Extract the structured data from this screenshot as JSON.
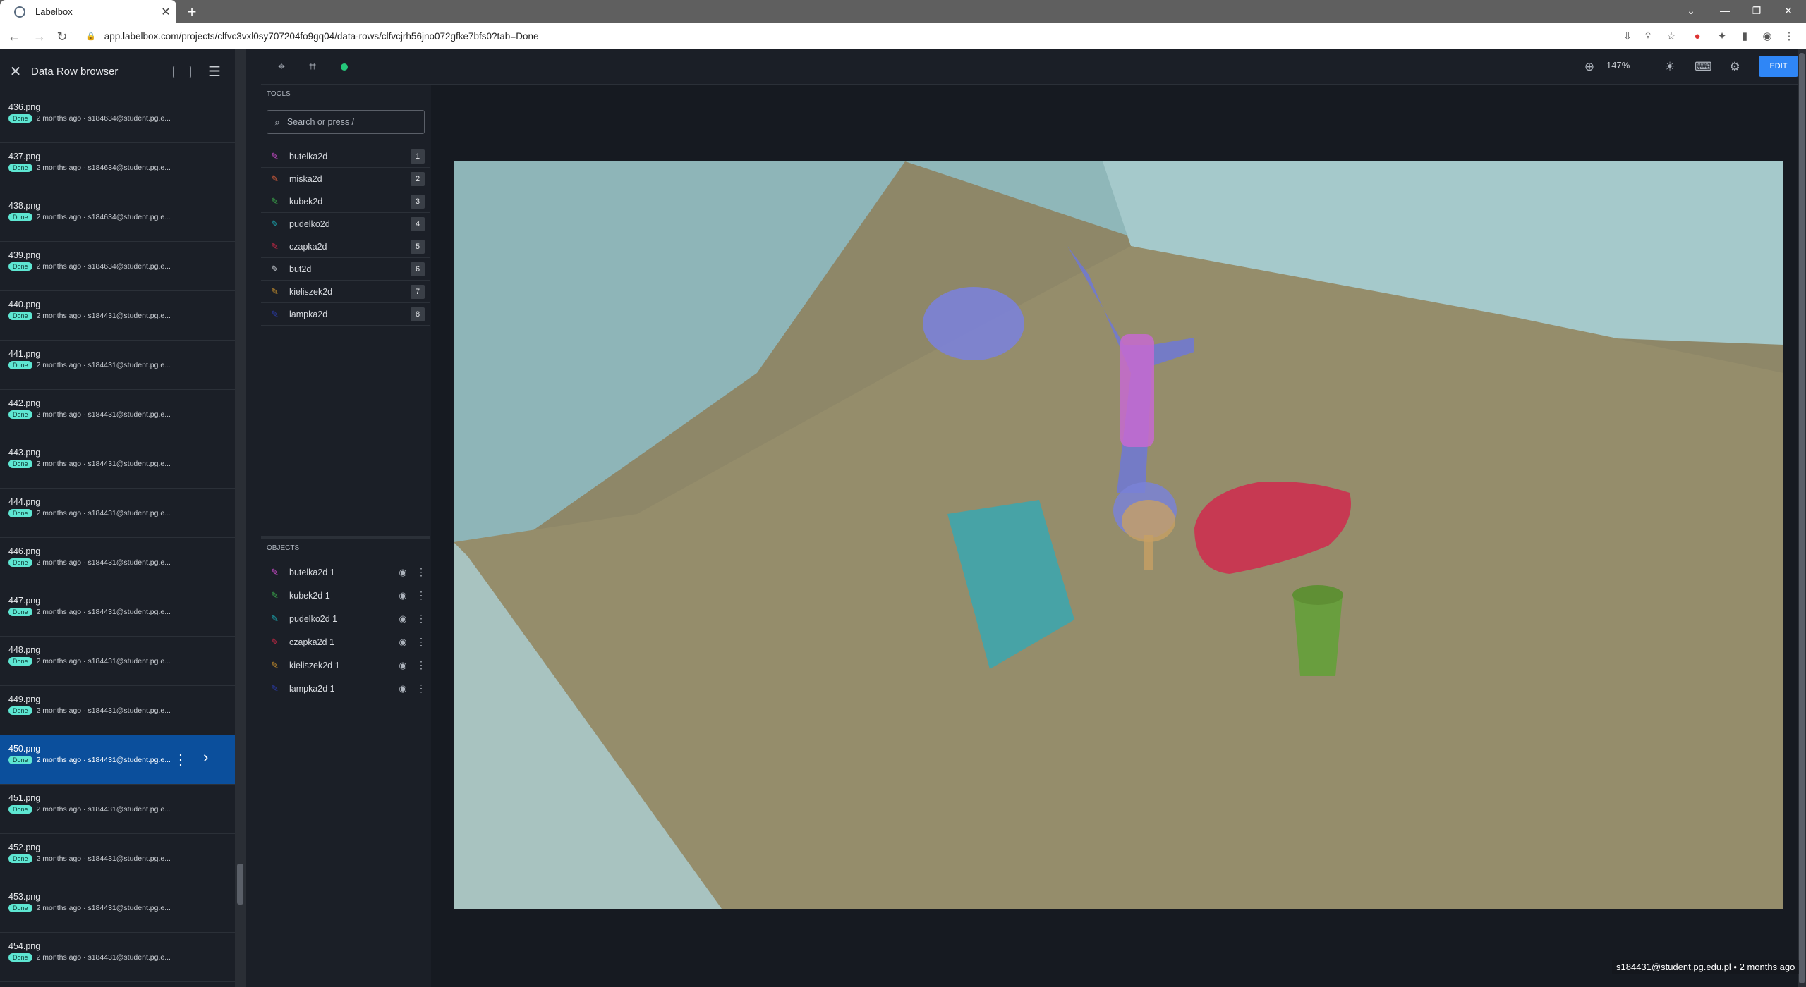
{
  "browser": {
    "tab_title": "Labelbox",
    "url": "app.labelbox.com/projects/clfvc3vxl0sy707204fo9gq04/data-rows/clfvcjrh56jno072gfke7bfs0?tab=Done"
  },
  "left_panel": {
    "title": "Data Row browser",
    "rows": [
      {
        "file": "436.png",
        "status": "Done",
        "meta": "2 months ago · s184634@student.pg.e..."
      },
      {
        "file": "437.png",
        "status": "Done",
        "meta": "2 months ago · s184634@student.pg.e..."
      },
      {
        "file": "438.png",
        "status": "Done",
        "meta": "2 months ago · s184634@student.pg.e..."
      },
      {
        "file": "439.png",
        "status": "Done",
        "meta": "2 months ago · s184634@student.pg.e..."
      },
      {
        "file": "440.png",
        "status": "Done",
        "meta": "2 months ago · s184431@student.pg.e..."
      },
      {
        "file": "441.png",
        "status": "Done",
        "meta": "2 months ago · s184431@student.pg.e..."
      },
      {
        "file": "442.png",
        "status": "Done",
        "meta": "2 months ago · s184431@student.pg.e..."
      },
      {
        "file": "443.png",
        "status": "Done",
        "meta": "2 months ago · s184431@student.pg.e..."
      },
      {
        "file": "444.png",
        "status": "Done",
        "meta": "2 months ago · s184431@student.pg.e..."
      },
      {
        "file": "446.png",
        "status": "Done",
        "meta": "2 months ago · s184431@student.pg.e..."
      },
      {
        "file": "447.png",
        "status": "Done",
        "meta": "2 months ago · s184431@student.pg.e..."
      },
      {
        "file": "448.png",
        "status": "Done",
        "meta": "2 months ago · s184431@student.pg.e..."
      },
      {
        "file": "449.png",
        "status": "Done",
        "meta": "2 months ago · s184431@student.pg.e..."
      },
      {
        "file": "450.png",
        "status": "Done",
        "meta": "2 months ago · s184431@student.pg.e..."
      },
      {
        "file": "451.png",
        "status": "Done",
        "meta": "2 months ago · s184431@student.pg.e..."
      },
      {
        "file": "452.png",
        "status": "Done",
        "meta": "2 months ago · s184431@student.pg.e..."
      },
      {
        "file": "453.png",
        "status": "Done",
        "meta": "2 months ago · s184431@student.pg.e..."
      },
      {
        "file": "454.png",
        "status": "Done",
        "meta": "2 months ago · s184431@student.pg.e..."
      }
    ],
    "active_file": "450.png"
  },
  "toolbar": {
    "zoom": "147%",
    "edit_label": "EDIT"
  },
  "tools": {
    "section_label": "TOOLS",
    "search_placeholder": "Search or press /",
    "items": [
      {
        "label": "butelka2d",
        "key": "1",
        "color": "#d04cd0"
      },
      {
        "label": "miska2d",
        "key": "2",
        "color": "#e0603c"
      },
      {
        "label": "kubek2d",
        "key": "3",
        "color": "#3aa64a"
      },
      {
        "label": "pudelko2d",
        "key": "4",
        "color": "#1aa7b0"
      },
      {
        "label": "czapka2d",
        "key": "5",
        "color": "#c82846"
      },
      {
        "label": "but2d",
        "key": "6",
        "color": "#c8ccd2"
      },
      {
        "label": "kieliszek2d",
        "key": "7",
        "color": "#c8902c"
      },
      {
        "label": "lampka2d",
        "key": "8",
        "color": "#2a3aa8"
      }
    ]
  },
  "objects": {
    "section_label": "OBJECTS",
    "items": [
      {
        "label": "butelka2d 1",
        "color": "#d04cd0"
      },
      {
        "label": "kubek2d 1",
        "color": "#3aa64a"
      },
      {
        "label": "pudelko2d 1",
        "color": "#1aa7b0"
      },
      {
        "label": "czapka2d 1",
        "color": "#c82846"
      },
      {
        "label": "kieliszek2d 1",
        "color": "#c8902c"
      },
      {
        "label": "lampka2d 1",
        "color": "#2a3aa8"
      }
    ]
  },
  "footer": {
    "info": "s184431@student.pg.edu.pl • 2 months ago"
  }
}
